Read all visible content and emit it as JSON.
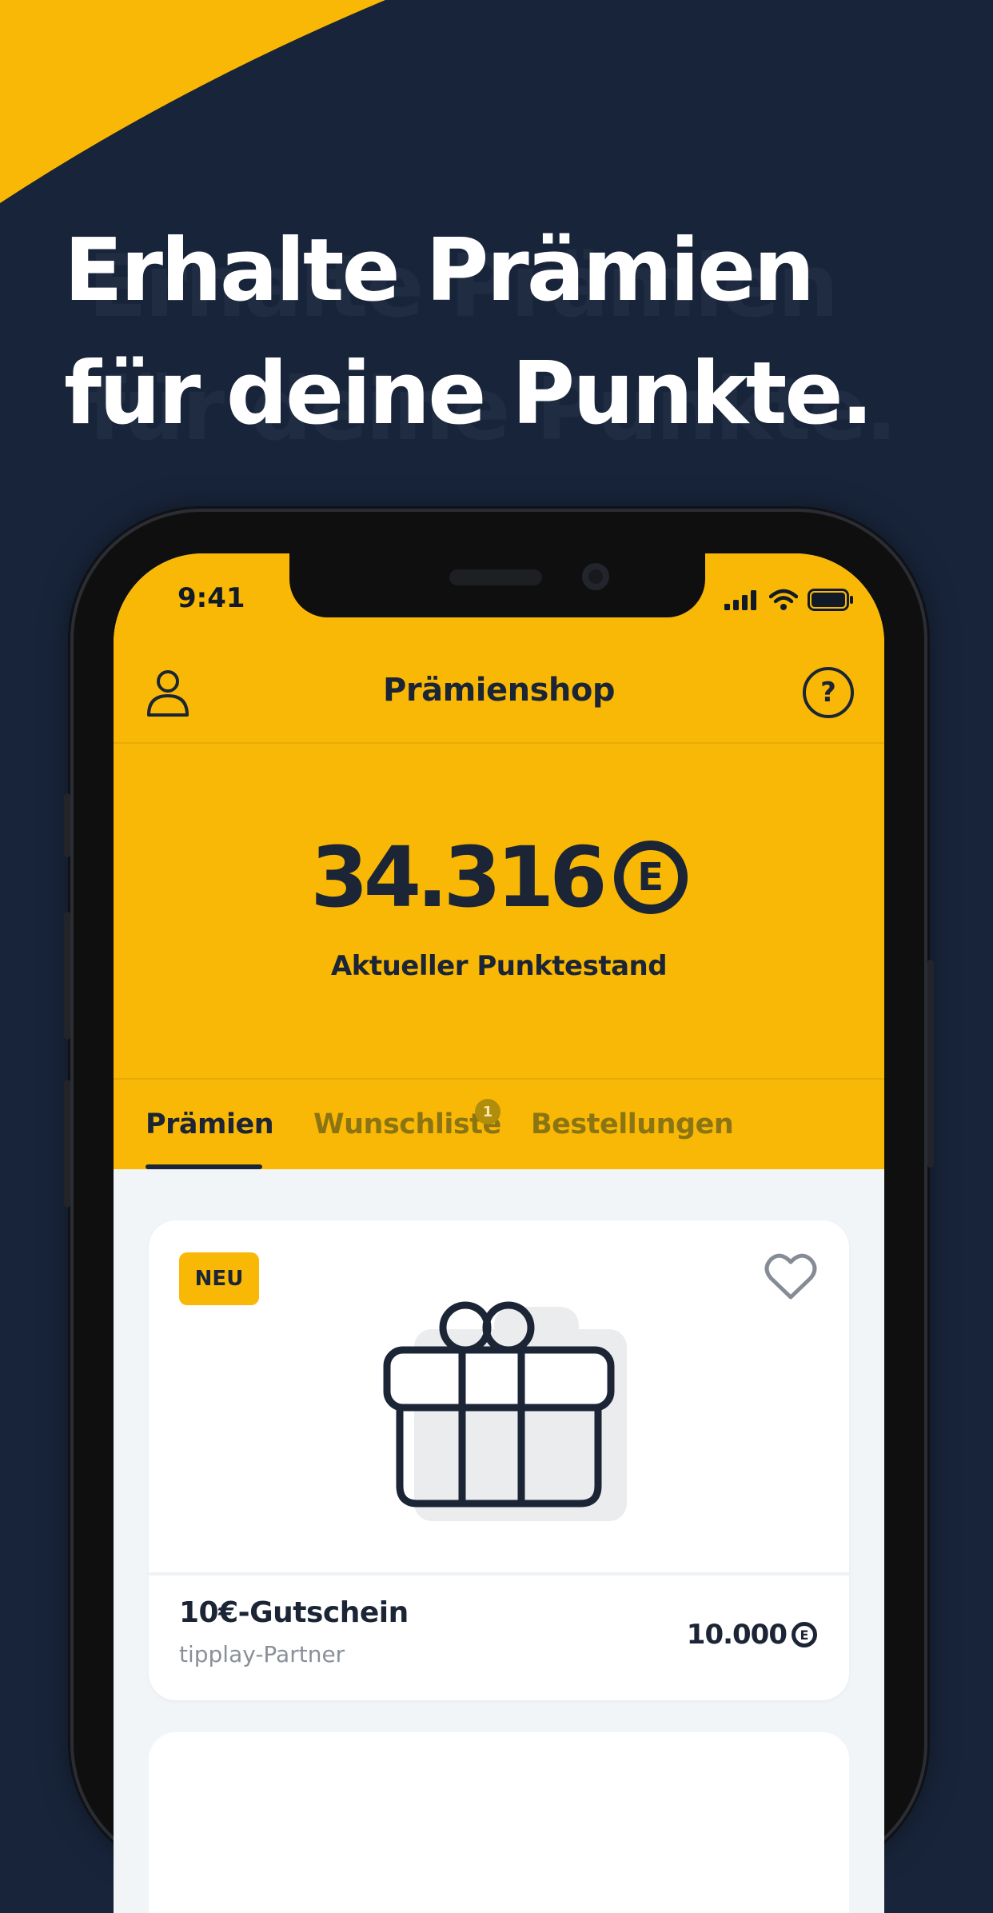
{
  "colors": {
    "background": "#18243a",
    "accent": "#f9b805",
    "text_dark": "#1b2536"
  },
  "headline": {
    "line1": "Erhalte Prämien",
    "line2": "für deine Punkte."
  },
  "status": {
    "time": "9:41"
  },
  "nav": {
    "title": "Prämienshop",
    "help_symbol": "?"
  },
  "balance": {
    "value": "34.316",
    "label": "Aktueller Punktestand",
    "coin_symbol": "E"
  },
  "tabs": [
    {
      "label": "Prämien",
      "active": true
    },
    {
      "label": "Wunschliste",
      "badge": "1"
    },
    {
      "label": "Bestellungen"
    }
  ],
  "card": {
    "badge": "NEU",
    "title": "10€-Gutschein",
    "subtitle": "tipplay-Partner",
    "price": "10.000",
    "coin_symbol": "E",
    "icons": {
      "image": "gift-icon",
      "favorite": "heart-icon"
    }
  }
}
